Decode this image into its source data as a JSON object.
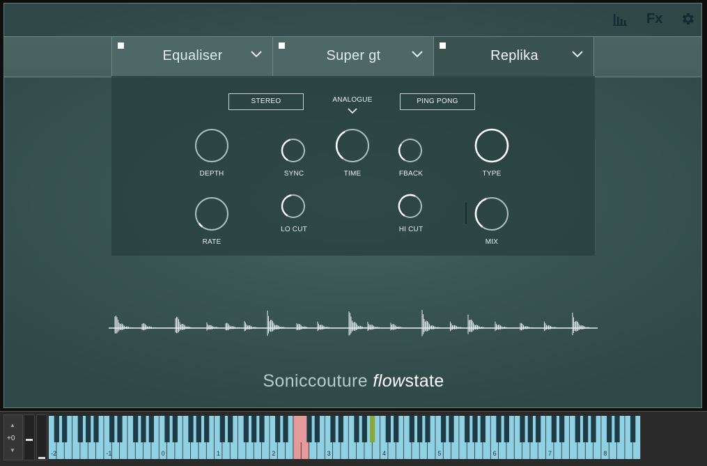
{
  "header": {
    "icons": [
      "mixer-bars-icon",
      "fx-label",
      "gear-icon"
    ],
    "fx_label": "Fx"
  },
  "tabs": [
    {
      "label": "Equaliser",
      "active": false
    },
    {
      "label": "Super gt",
      "active": false
    },
    {
      "label": "Replika",
      "active": true
    }
  ],
  "fx": {
    "stereo_label": "STEREO",
    "mode_label": "ANALOGUE",
    "pingpong_label": "PING PONG",
    "knobs": {
      "depth": {
        "label": "DEPTH"
      },
      "sync": {
        "label": "SYNC"
      },
      "time": {
        "label": "TIME"
      },
      "fback": {
        "label": "FBACK"
      },
      "type": {
        "label": "TYPE"
      },
      "rate": {
        "label": "RATE"
      },
      "locut": {
        "label": "LO CUT"
      },
      "hicut": {
        "label": "HI CUT"
      },
      "mix": {
        "label": "MIX"
      }
    }
  },
  "brand": {
    "company": "Soniccouture",
    "product_a": "flow",
    "product_b": "state"
  },
  "keyboard": {
    "octave_value": "+0",
    "octave_labels": [
      "-2",
      "-1",
      "0",
      "1",
      "2",
      "3",
      "4",
      "5",
      "6",
      "7",
      "8"
    ],
    "colors": {
      "white_key": "#8fd0e3",
      "black_key": "#1d3a45",
      "highlight": "#e49a9a",
      "marker": "#8aa83a"
    }
  }
}
